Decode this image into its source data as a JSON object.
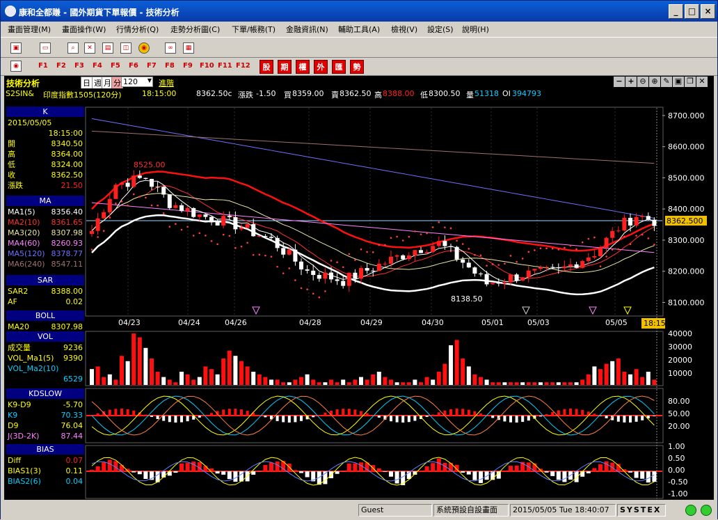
{
  "window": {
    "title": "康和全都賺 - 國外期貨下單報價 - 技術分析",
    "min": "_",
    "max": "□",
    "close": "×"
  },
  "menu": [
    "畫面管理(M)",
    "畫面操作(W)",
    "行情分析(Q)",
    "走勢分析圖(C)",
    "下單/帳務(T)",
    "金融資訊(N)",
    "輔助工具(A)",
    "檢視(V)",
    "設定(S)",
    "說明(H)"
  ],
  "fkeys": [
    "F1",
    "F2",
    "F3",
    "F4",
    "F5",
    "F6",
    "F7",
    "F8",
    "F9",
    "F10",
    "F11",
    "F12"
  ],
  "catbtns": [
    "股",
    "期",
    "權",
    "外",
    "匯",
    "勢"
  ],
  "header": {
    "title": "技術分析",
    "periods": [
      "日",
      "週",
      "月",
      "分"
    ],
    "interval": "120",
    "advanced": "進階"
  },
  "quote": {
    "symbol": "S2SIN&",
    "name": "印度指數1505(120分)",
    "time": "18:15:00",
    "last": "8362.50c",
    "change_label": "漲跌",
    "change": "-1.50",
    "bid_label": "買",
    "bid": "8359.00",
    "ask_label": "賣",
    "ask": "8362.50",
    "high_label": "高",
    "high": "8388.00",
    "low_label": "低",
    "low": "8300.50",
    "vol_label": "量",
    "vol": "51318",
    "oi_label": "OI",
    "oi": "394793"
  },
  "left": {
    "k": {
      "head": "K",
      "date": "2015/05/05",
      "time": "18:15:00",
      "rows": [
        [
          "開",
          "8340.50"
        ],
        [
          "高",
          "8364.00"
        ],
        [
          "低",
          "8324.00"
        ],
        [
          "收",
          "8362.50"
        ],
        [
          "漲跌",
          "21.50"
        ]
      ]
    },
    "ma": {
      "head": "MA",
      "rows": [
        [
          "MA1(5)",
          "8356.40"
        ],
        [
          "MA2(10)",
          "8361.65"
        ],
        [
          "MA3(20)",
          "8307.98"
        ],
        [
          "MA4(60)",
          "8260.93"
        ],
        [
          "MA5(120)",
          "8378.77"
        ],
        [
          "MA6(240)",
          "8547.11"
        ]
      ]
    },
    "sar": {
      "head": "SAR",
      "rows": [
        [
          "SAR2",
          "8388.00"
        ],
        [
          "AF",
          "0.02"
        ]
      ]
    },
    "boll": {
      "head": "BOLL",
      "rows": [
        [
          "MA20",
          "8307.98"
        ]
      ]
    },
    "vol": {
      "head": "VOL",
      "rows": [
        [
          "成交量",
          "9236"
        ],
        [
          "VOL_Ma1(5)",
          "9390"
        ],
        [
          "VOL_Ma2(10)",
          ""
        ],
        [
          "",
          "6529"
        ]
      ]
    },
    "kd": {
      "head": "KDSLOW",
      "rows": [
        [
          "K9-D9",
          "-5.70"
        ],
        [
          "K9",
          "70.33"
        ],
        [
          "D9",
          "76.04"
        ],
        [
          "J(3D-2K)",
          "87.44"
        ]
      ]
    },
    "bias": {
      "head": "BIAS",
      "rows": [
        [
          "Diff",
          "0.07"
        ],
        [
          "BIAS1(3)",
          "0.11"
        ],
        [
          "BIAS2(6)",
          "0.04"
        ]
      ]
    }
  },
  "chart": {
    "price_axis": [
      "8700.000",
      "8600.000",
      "8500.000",
      "8400.000",
      "8300.000",
      "8200.000",
      "8100.000"
    ],
    "current_price": "8362.500",
    "high_mark": "8525.00",
    "low_mark": "8138.50",
    "dates": [
      "04/23",
      "04/24",
      "04/26",
      "04/28",
      "04/29",
      "04/30",
      "05/01",
      "05/03",
      "05/05"
    ],
    "cursor_time": "18:15",
    "vol_axis": [
      "40000",
      "30000",
      "20000",
      "10000"
    ],
    "kd_axis": [
      "80.00",
      "50.00",
      "20.00"
    ],
    "bias_axis": [
      "1.00",
      "0.50",
      "0.00",
      "-0.50",
      "-1.00"
    ]
  },
  "status": {
    "user": "Guest",
    "layout": "系統預設自設畫面",
    "datetime": "2015/05/05 Tue 18:40:07",
    "brand": "SYSTEX"
  }
}
